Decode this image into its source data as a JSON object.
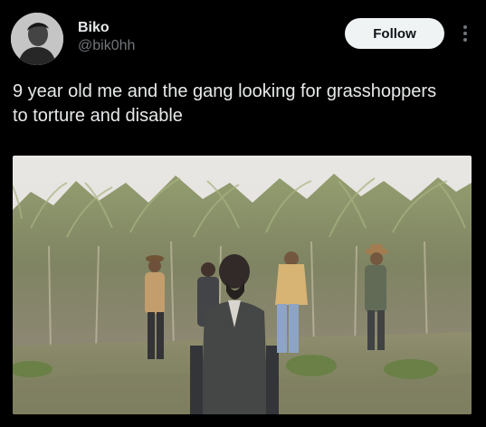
{
  "author": {
    "name": "Biko",
    "handle": "@bik0hh"
  },
  "actions": {
    "follow_label": "Follow",
    "more_icon": "more-vertical-icon"
  },
  "post": {
    "text": "9 year old me and the gang looking for grasshoppers\nto torture and disable"
  },
  "colors": {
    "background": "#000000",
    "primary_text": "#e7e9ea",
    "secondary_text": "#71767b",
    "follow_button_bg": "#eff3f4"
  }
}
